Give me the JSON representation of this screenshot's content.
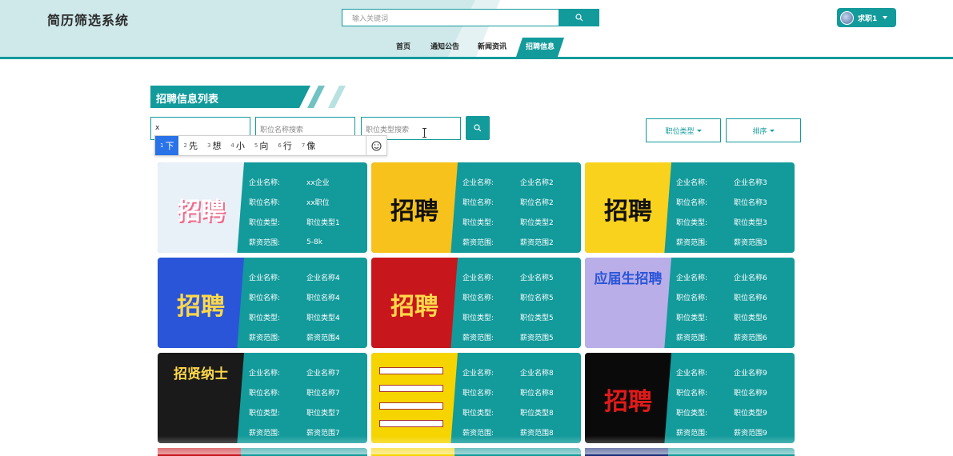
{
  "site_title": "简历筛选系统",
  "search": {
    "placeholder": "输入关键词"
  },
  "user": {
    "label": "求职1"
  },
  "nav": [
    {
      "label": "首页"
    },
    {
      "label": "通知公告"
    },
    {
      "label": "新闻资讯"
    },
    {
      "label": "招聘信息",
      "active": true
    }
  ],
  "section_title": "招聘信息列表",
  "filters": {
    "company_value": "x",
    "position_placeholder": "职位名称搜索",
    "type_placeholder": "职位类型搜索",
    "type_dropdown": "职位类型",
    "sort_dropdown": "排序"
  },
  "ime": {
    "candidates": [
      {
        "num": "1",
        "text": "下"
      },
      {
        "num": "2",
        "text": "先"
      },
      {
        "num": "3",
        "text": "想"
      },
      {
        "num": "4",
        "text": "小"
      },
      {
        "num": "5",
        "text": "向"
      },
      {
        "num": "6",
        "text": "行"
      },
      {
        "num": "7",
        "text": "像"
      }
    ],
    "emoji_icon": "smiley-icon"
  },
  "field_labels": {
    "company": "企业名称:",
    "position": "职位名称:",
    "type": "职位类型:",
    "salary": "薪资范围:"
  },
  "cards": [
    {
      "company": "xx企业",
      "position": "xx职位",
      "type": "职位类型1",
      "salary": "5-8k",
      "image_text": "招聘",
      "image_bg": "#e8f0f8"
    },
    {
      "company": "企业名称2",
      "position": "职位名称2",
      "type": "职位类型2",
      "salary": "薪资范围2",
      "image_text": "招聘",
      "image_bg": "#f6c21b"
    },
    {
      "company": "企业名称3",
      "position": "职位名称3",
      "type": "职位类型3",
      "salary": "薪资范围3",
      "image_text": "招聘",
      "image_bg": "#f9d21e"
    },
    {
      "company": "企业名称4",
      "position": "职位名称4",
      "type": "职位类型4",
      "salary": "薪资范围4",
      "image_text": "招聘",
      "image_bg": "#2a55d8"
    },
    {
      "company": "企业名称5",
      "position": "职位名称5",
      "type": "职位类型5",
      "salary": "薪资范围5",
      "image_text": "招聘",
      "image_bg": "#c8161d"
    },
    {
      "company": "企业名称6",
      "position": "职位名称6",
      "type": "职位类型6",
      "salary": "薪资范围6",
      "image_text": "应届生招聘",
      "image_bg": "#b9aee8"
    },
    {
      "company": "企业名称7",
      "position": "职位名称7",
      "type": "职位类型7",
      "salary": "薪资范围7",
      "image_text": "招贤纳士",
      "image_bg": "#1a1a1a"
    },
    {
      "company": "企业名称8",
      "position": "职位名称8",
      "type": "职位类型8",
      "salary": "薪资范围8",
      "image_text": "",
      "image_bg": "#f5d400"
    },
    {
      "company": "企业名称9",
      "position": "职位名称9",
      "type": "职位类型9",
      "salary": "薪资范围9",
      "image_text": "招聘",
      "image_bg": "#0a0a0a"
    }
  ],
  "colors": {
    "accent": "#139a9b",
    "header_bg": "#cfe8ea"
  }
}
